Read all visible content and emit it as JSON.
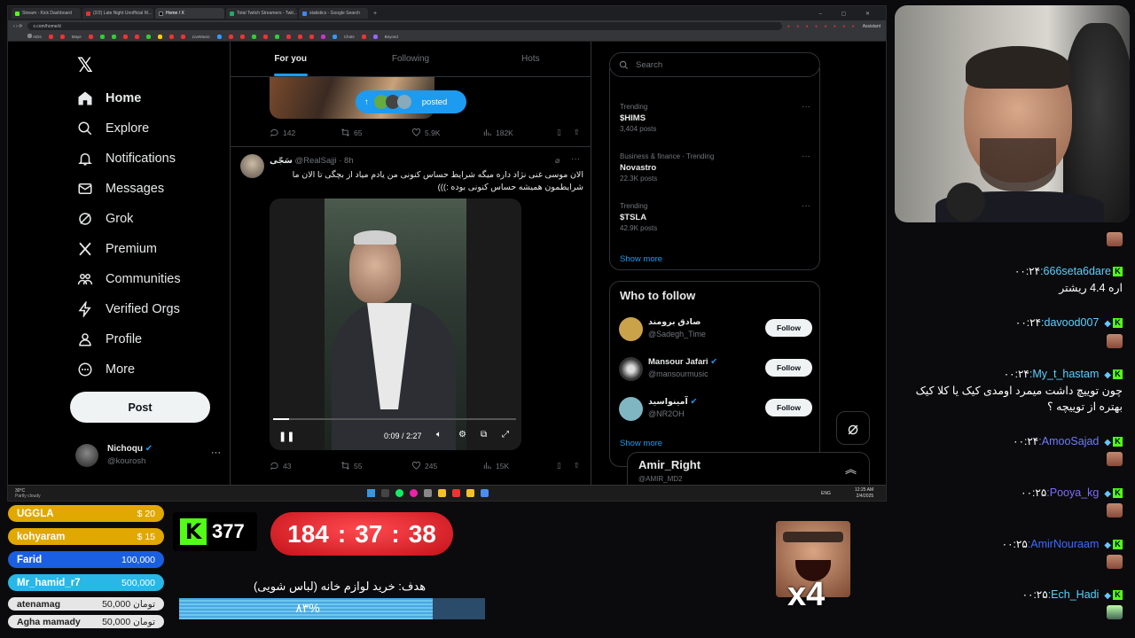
{
  "browser": {
    "tabs": [
      "Stream - Kick Dashboard",
      "(2/2) Late Night Unofficial M...",
      "Home / X",
      "Total Twitch Streamers - Twit...",
      "statistics - Google Search"
    ],
    "url": "x.com/home/d",
    "assistant": "Assistant",
    "bookmarks": [
      "AIDs",
      "Maye",
      "LiveMusic",
      "Chats",
      "Beyond"
    ]
  },
  "x": {
    "nav": [
      "Home",
      "Explore",
      "Notifications",
      "Messages",
      "Grok",
      "Premium",
      "Communities",
      "Verified Orgs",
      "Profile",
      "More"
    ],
    "post_label": "Post",
    "account": {
      "name": "Nichoqu",
      "handle": "@kourosh"
    },
    "feed_tabs": [
      "For you",
      "Following",
      "Hots"
    ],
    "posted_pill": "posted",
    "post1_actions": {
      "reply": "142",
      "repost": "65",
      "like": "5.9K",
      "views": "182K"
    },
    "post2": {
      "name": "سَجّی",
      "handle": "@RealSajji",
      "time": "· 8h",
      "text_line1": "الان موسی غنی نژاد داره میگه شرایط حساس کنونی من یادم میاد از بچگی تا الان ما",
      "text_line2": "شرایطمون همیشه حساس کنونی بوده :)))",
      "video_time": "0:09 / 2:27",
      "video_progress": 0.065,
      "actions": {
        "reply": "43",
        "repost": "55",
        "like": "245",
        "views": "15K"
      }
    },
    "search_placeholder": "Search",
    "trends": [
      {
        "context": "Trending",
        "name": "$HIMS",
        "posts": "3,404 posts"
      },
      {
        "context": "Business & finance · Trending",
        "name": "Novastro",
        "posts": "22.3K posts"
      },
      {
        "context": "Trending",
        "name": "$TSLA",
        "posts": "42.9K posts"
      }
    ],
    "show_more": "Show more",
    "who_to_follow": "Who to follow",
    "follow_suggestions": [
      {
        "name": "صادق برومند",
        "handle": "@Sadegh_Time",
        "color": "#caa24a"
      },
      {
        "name": "Mansour Jafari",
        "handle": "@mansourmusic",
        "color": "#555"
      },
      {
        "name": "آمینواسید",
        "handle": "@NR2OH",
        "color": "#7fb6c2"
      }
    ],
    "follow_label": "Follow",
    "messages_drawer": {
      "name": "Amir_Right",
      "handle": "@AMIR_MD2"
    }
  },
  "taskbar": {
    "weather": "30°C",
    "weather_sub": "Partly cloudy",
    "lang": "ENG",
    "time": "12:25 AM",
    "date": "2/4/2025"
  },
  "chat": [
    {
      "time": "۰۰:۲۴",
      "user": "666seta6dare",
      "color": "#5ad1ff",
      "text": "اره 4.4 ریشتر"
    },
    {
      "time": "۰۰:۲۴",
      "user": "davood007",
      "color": "#5ad1ff",
      "text": ""
    },
    {
      "time": "۰۰:۲۴",
      "user": "My_t_hastam",
      "color": "#5ad1ff",
      "text": "چون توییچ داشت میمرد اومدی کیک یا کلا کیک بهتره از توییچه ؟"
    },
    {
      "time": "۰۰:۲۴",
      "user": "AmooSajad",
      "color": "#6e7bff",
      "text": ""
    },
    {
      "time": "۰۰:۲۵",
      "user": "Pooya_kg",
      "color": "#7c6bff",
      "text": ""
    },
    {
      "time": "۰۰:۲۵",
      "user": "AmirNouraam",
      "color": "#3b6bff",
      "text": ""
    },
    {
      "time": "۰۰:۲۵",
      "user": "Ech_Hadi",
      "color": "#5ad1ff",
      "text": ""
    }
  ],
  "donations": [
    {
      "name": "UGGLA",
      "amount": "$ 20",
      "bg": "#e0a800"
    },
    {
      "name": "kohyaram",
      "amount": "$ 15",
      "bg": "#e0a800"
    },
    {
      "name": "Farid",
      "amount": "100,000",
      "bg": "#1a5fe0"
    },
    {
      "name": "Mr_hamid_r7",
      "amount": "500,000",
      "bg": "#28b7e6"
    },
    {
      "name": "atenamag",
      "amount": "50,000 تومان",
      "bg": "#e6e6e6"
    },
    {
      "name": "Agha mamady",
      "amount": "50,000 تومان",
      "bg": "#e6e6e6"
    }
  ],
  "kick_count": "377",
  "timer": {
    "h": "184",
    "m": "37",
    "s": "38"
  },
  "goal": {
    "label": "هدف: خرید لوازم خانه (لباس شویی)",
    "percent_text": "۸۳%",
    "progress": 0.83
  },
  "emote_multiplier": "x4"
}
